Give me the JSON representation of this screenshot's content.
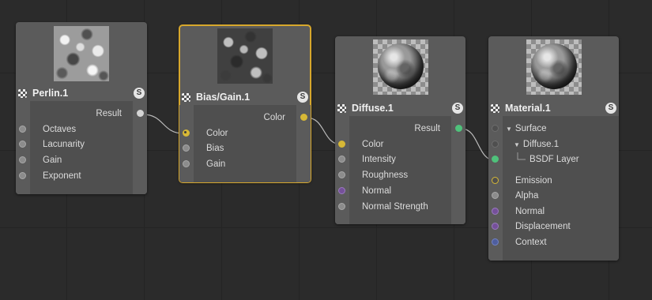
{
  "colors": {
    "background": "#2b2b2b",
    "node_body": "#5b5b5b",
    "selected_outline": "#d7a72c",
    "port_grey": "#8c8c8c",
    "port_yellow": "#d7b836",
    "port_green": "#4fc27b",
    "port_purple": "#75509a",
    "port_blue": "#4e5e9e",
    "wire": "#bdbdbd"
  },
  "nodes": {
    "perlin": {
      "title": "Perlin.1",
      "solo": "S",
      "icon": "texture-node-icon",
      "preview": "noise-preview",
      "output": "Result",
      "inputs": [
        "Octaves",
        "Lacunarity",
        "Gain",
        "Exponent"
      ]
    },
    "biasgain": {
      "title": "Bias/Gain.1",
      "solo": "S",
      "icon": "texture-node-icon",
      "preview": "noise-preview",
      "selected": true,
      "output": "Color",
      "inputs": [
        "Color",
        "Bias",
        "Gain"
      ]
    },
    "diffuse": {
      "title": "Diffuse.1",
      "solo": "S",
      "icon": "material-node-icon",
      "preview": "sphere-preview",
      "output": "Result",
      "inputs": [
        "Color",
        "Intensity",
        "Roughness",
        "Normal",
        "Normal Strength"
      ]
    },
    "material": {
      "title": "Material.1",
      "solo": "S",
      "icon": "material-node-icon",
      "preview": "sphere-preview",
      "tree": [
        "Surface",
        "Diffuse.1",
        "BSDF Layer"
      ],
      "inputs": [
        "Emission",
        "Alpha",
        "Normal",
        "Displacement",
        "Context"
      ]
    }
  }
}
